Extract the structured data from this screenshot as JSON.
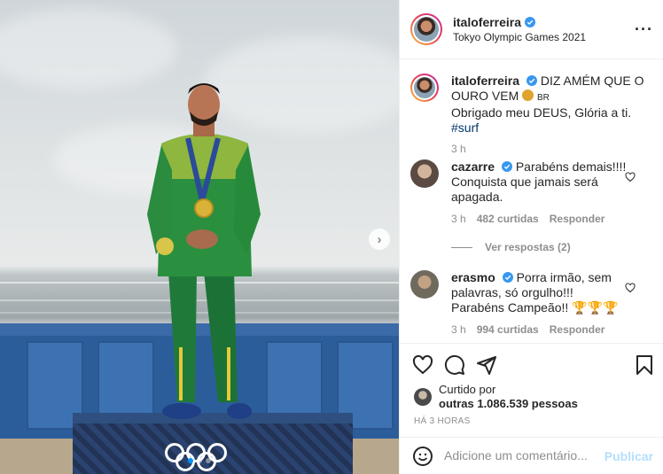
{
  "post": {
    "author": {
      "username": "italoferreira",
      "verified": true,
      "location": "Tokyo Olympic Games 2021"
    },
    "caption": {
      "username": "italoferreira",
      "text_line1": "DIZ AMÉM QUE O",
      "text_line2": "OURO VEM",
      "flag_text": "BR",
      "text_line3": "Obrigado meu DEUS, Glória a ti.",
      "hashtag": "#surf",
      "time": "3 h"
    },
    "comments": [
      {
        "username": "cazarre",
        "text": "Parabéns demais!!!! Conquista que jamais será apagada.",
        "time": "3 h",
        "likes": "482 curtidas",
        "reply_label": "Responder",
        "view_replies": "Ver respostas (2)"
      },
      {
        "username": "erasmo",
        "text": "Porra irmão, sem palavras, só orgulho!!! Parabéns Campeão!!",
        "trophies": "🏆🏆🏆",
        "time": "3 h",
        "likes": "994 curtidas",
        "reply_label": "Responder"
      }
    ],
    "likes": {
      "liked_by_label": "Curtido por",
      "others_label": "outras 1.086.539 pessoas"
    },
    "time_ago": "HÁ 3 HORAS",
    "add_comment": {
      "placeholder": "Adicione um comentário...",
      "publish_label": "Publicar"
    },
    "icons": {
      "like": "heart-icon",
      "comment": "comment-icon",
      "share": "share-icon",
      "save": "bookmark-icon",
      "emoji": "smile-icon",
      "more": "more-icon",
      "next": "chevron-right-icon"
    },
    "colors": {
      "link": "#00376b",
      "publish_disabled": "#b2dffc",
      "active_dot": "#0095f6",
      "secondary_text": "#8e8e8e"
    },
    "carousel": {
      "slides": 3,
      "active": 1
    }
  }
}
